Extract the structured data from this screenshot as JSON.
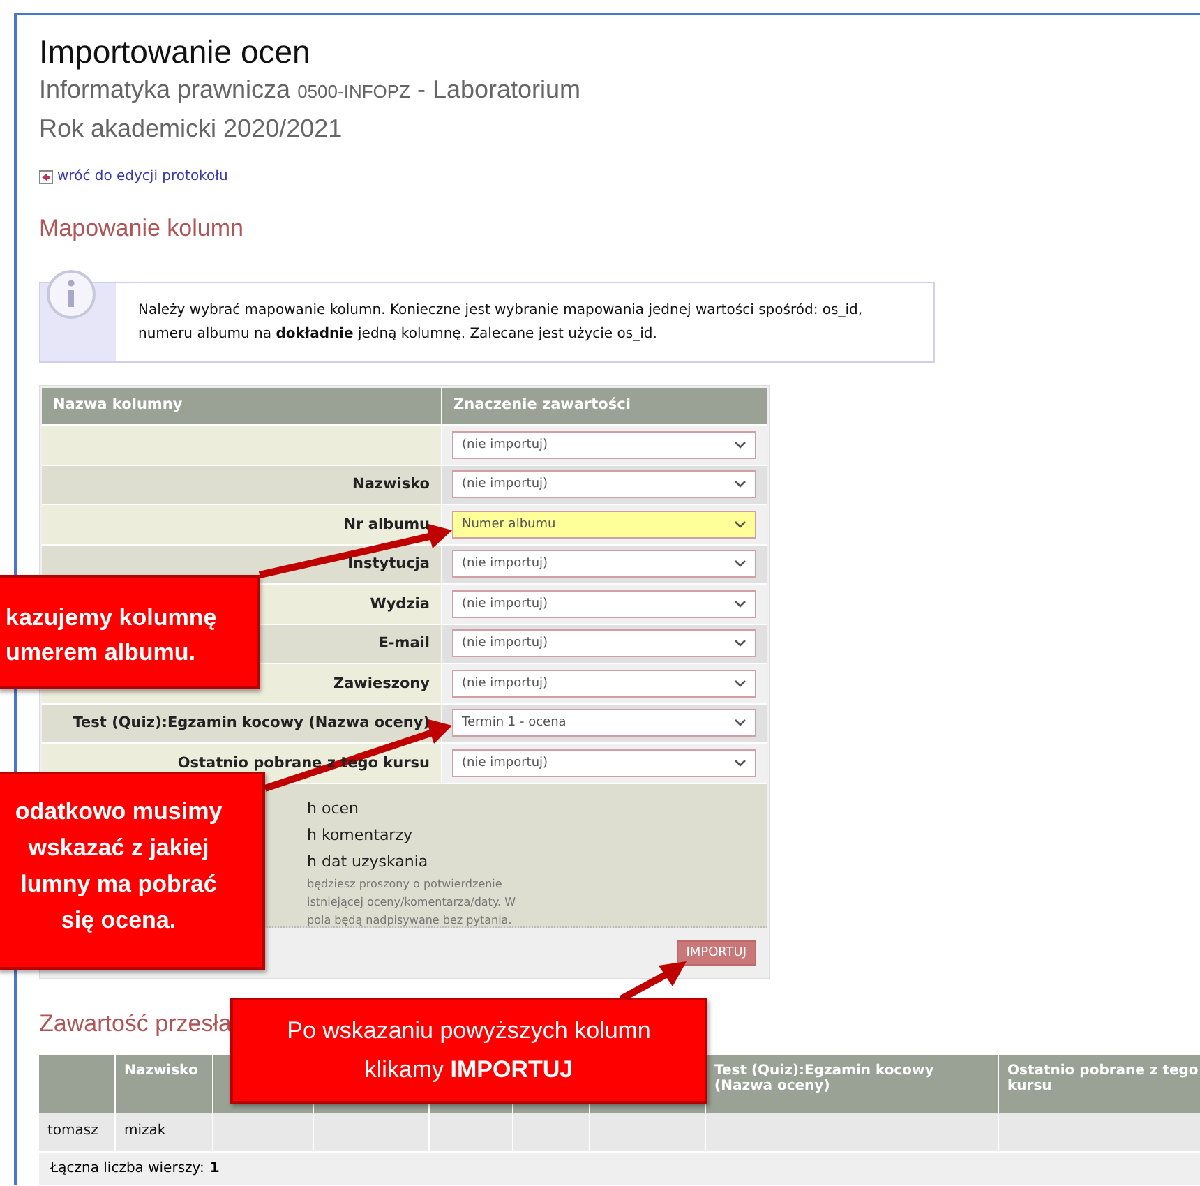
{
  "page": {
    "title": "Importowanie ocen",
    "course_name": "Informatyka prawnicza",
    "course_code": "0500-INFOPZ",
    "course_type": "- Laboratorium",
    "year": "Rok akademicki 2020/2021",
    "back_link": "wróć do edycji protokołu"
  },
  "mapping": {
    "heading": "Mapowanie kolumn",
    "info": "Należy wybrać mapowanie kolumn. Konieczne jest wybranie mapowania jednej wartości spośród: os_id, numeru albumu na **dokładnie** jedną kolumnę. Zalecane jest użycie os_id.",
    "columns": [
      "Nazwa kolumny",
      "Znaczenie zawartości"
    ],
    "rows": [
      {
        "value": "(nie importuj)",
        "highlighted": false
      },
      {
        "label": "Nazwisko",
        "value": "(nie importuj)",
        "highlighted": false
      },
      {
        "label": "Nr albumu",
        "value": "Numer albumu",
        "highlighted": true
      },
      {
        "label": "Instytucja",
        "value": "(nie importuj)",
        "highlighted": false
      },
      {
        "label": "Wydzia",
        "value": "(nie importuj)",
        "highlighted": false
      },
      {
        "label": "E-mail",
        "value": "(nie importuj)",
        "highlighted": false
      },
      {
        "label": "Zawieszony",
        "value": "(nie importuj)",
        "highlighted": false
      },
      {
        "label": "Test (Quiz):Egzamin kocowy (Nazwa oceny)",
        "value": "Termin 1 - ocena",
        "highlighted": false
      },
      {
        "label": "Ostatnio pobrane z tego kursu",
        "value": "(nie importuj)",
        "highlighted": false
      }
    ],
    "options": [
      "h ocen",
      "h komentarzy",
      "h dat uzyskania"
    ],
    "note": [
      "będziesz proszony o potwierdzenie",
      "istniejącej oceny/komentarza/daty. W",
      "pola będą nadpisywane bez pytania."
    ],
    "button": "IMPORTUJ"
  },
  "content": {
    "heading": "Zawartość przesła",
    "header_cells": [
      {},
      {
        "label": "Nazwisko"
      },
      {},
      {},
      {},
      {},
      {},
      {
        "label": "Test (Quiz):Egzamin kocowy (Nazwa oceny)"
      },
      {
        "label": "Ostatnio pobrane z tego kursu"
      }
    ],
    "rows": [
      {
        "cells": [
          "tomasz",
          "mizak"
        ]
      }
    ],
    "total_label": "Łączna liczba wierszy:",
    "total": "1"
  },
  "callouts": [
    {
      "lines": [
        "kazujemy kolumnę",
        "umerem albumu."
      ]
    },
    {
      "lines": [
        "odatkowo musimy",
        "wskazać z jakiej",
        "lumny ma pobrać",
        "się ocena."
      ]
    },
    {
      "lines": [
        "Po wskazaniu powyższych kolumn",
        "klikamy **IMPORTUJ**"
      ]
    }
  ]
}
